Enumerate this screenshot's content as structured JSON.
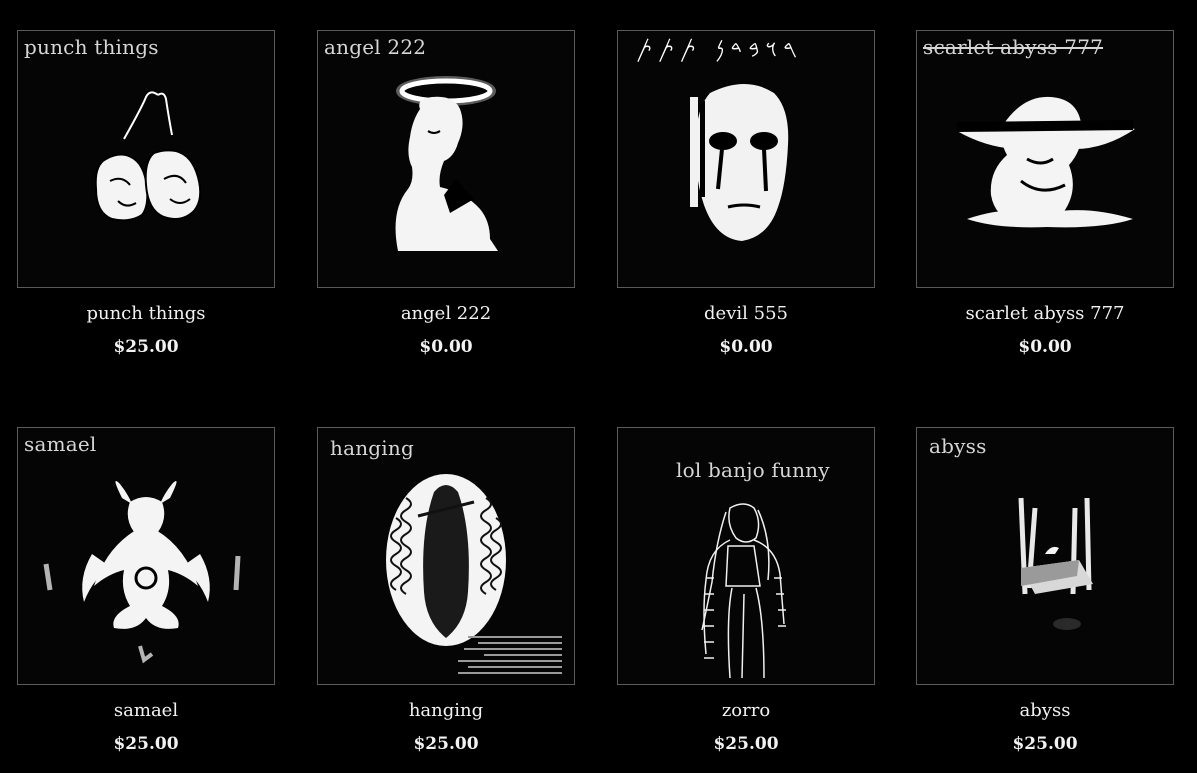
{
  "products": [
    {
      "title": "punch things",
      "price": "$25.00",
      "art_caption": "punch things",
      "art_icon": "boxing-gloves-icon"
    },
    {
      "title": "angel 222",
      "price": "$0.00",
      "art_caption": "angel 222",
      "art_icon": "halo-statue-icon"
    },
    {
      "title": "devil 555",
      "price": "$0.00",
      "art_caption": "𐤓𐤅𐤁𐤃𐤍 𐤕𐤕𐤕",
      "art_icon": "white-mask-icon"
    },
    {
      "title": "scarlet abyss 777",
      "price": "$0.00",
      "art_caption": "scarlet abyss 777",
      "art_icon": "cherub-icon"
    },
    {
      "title": "samael",
      "price": "$25.00",
      "art_caption": "samael",
      "art_icon": "baphomet-icon"
    },
    {
      "title": "hanging",
      "price": "$25.00",
      "art_caption": "hanging",
      "art_icon": "virgin-oval-icon"
    },
    {
      "title": "zorro",
      "price": "$25.00",
      "art_caption": "lol banjo funny",
      "art_icon": "girl-outline-icon"
    },
    {
      "title": "abyss",
      "price": "$25.00",
      "art_caption": "abyss",
      "art_icon": "floating-chair-icon"
    }
  ],
  "colors": {
    "background": "#000000",
    "text": "#f2f2f2",
    "frame": "#5a5a5a"
  }
}
